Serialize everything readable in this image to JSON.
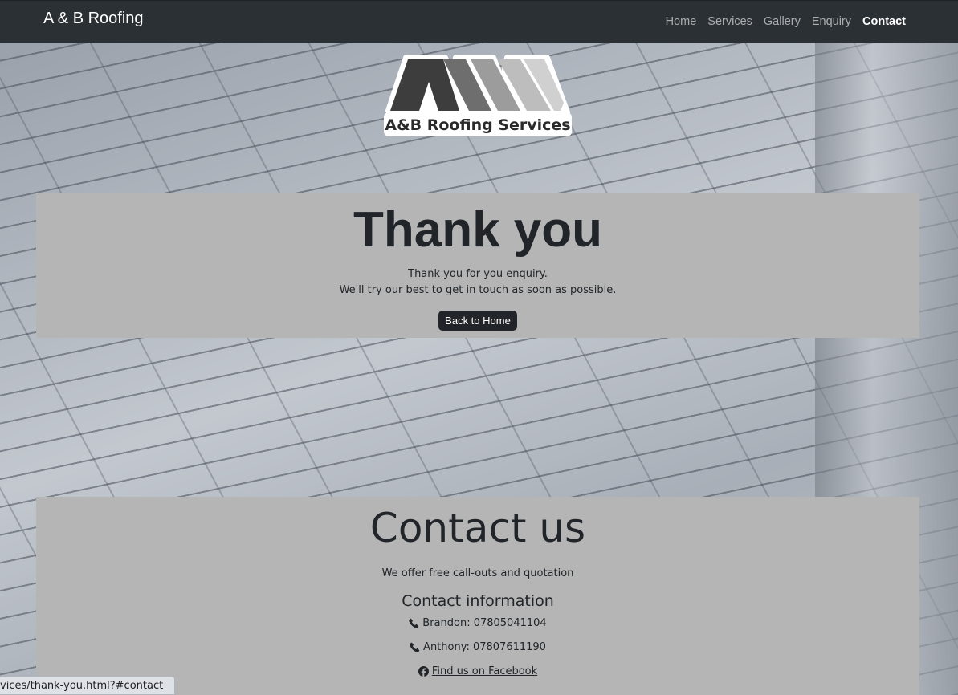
{
  "navbar": {
    "brand": "A & B Roofing",
    "links": [
      "Home",
      "Services",
      "Gallery",
      "Enquiry",
      "Contact"
    ],
    "active": "Contact"
  },
  "logo": {
    "text": "A&B Roofing Services"
  },
  "thanks": {
    "title": "Thank you",
    "line1": "Thank you for you enquiry.",
    "line2": "We'll try our best to get in touch as soon as possible.",
    "button": "Back to Home"
  },
  "contact": {
    "title": "Contact us",
    "offer": "We offer free call-outs and quotation",
    "info_title": "Contact information",
    "phone1": "Brandon: 07805041104",
    "phone2": "Anthony: 07807611190",
    "facebook": " Find us on Facebook"
  },
  "status": {
    "url": "vices/thank-you.html?#contact"
  },
  "icons": {
    "phone": "phone-icon",
    "facebook": "facebook-icon"
  },
  "colors": {
    "navbar_bg": "#2b3035",
    "panel_bg": "#b5b5b5",
    "button_bg": "#212529"
  }
}
